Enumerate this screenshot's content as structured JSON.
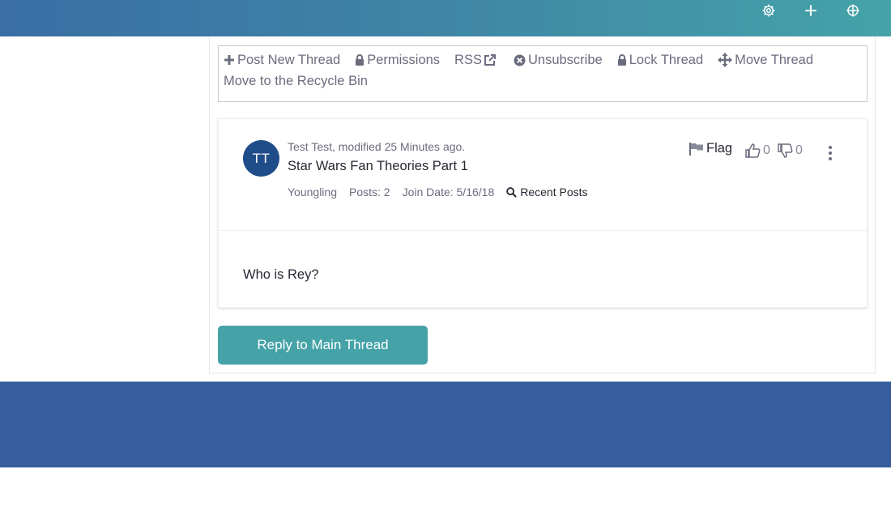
{
  "header": {
    "icons": [
      "gear-icon",
      "plus-icon",
      "crosshair-icon"
    ]
  },
  "toolbar": {
    "post_new_thread": "Post New Thread",
    "permissions": "Permissions",
    "rss": "RSS",
    "unsubscribe": "Unsubscribe",
    "lock_thread": "Lock Thread",
    "move_thread": "Move Thread",
    "recycle_bin": "Move to the Recycle Bin"
  },
  "post": {
    "avatar_initials": "TT",
    "meta": "Test Test, modified 25 Minutes ago.",
    "title": "Star Wars Fan Theories Part 1",
    "rank": "Youngling",
    "posts": "Posts: 2",
    "join_date": "Join Date: 5/16/18",
    "recent_posts": "Recent Posts",
    "flag_label": "Flag",
    "thumbs_up_count": "0",
    "thumbs_down_count": "0",
    "body": "Who is Rey?"
  },
  "reply_button": "Reply to Main Thread",
  "colors": {
    "accent": "#45a3a8",
    "footer": "#365d9e",
    "avatar": "#1f4d8a"
  }
}
